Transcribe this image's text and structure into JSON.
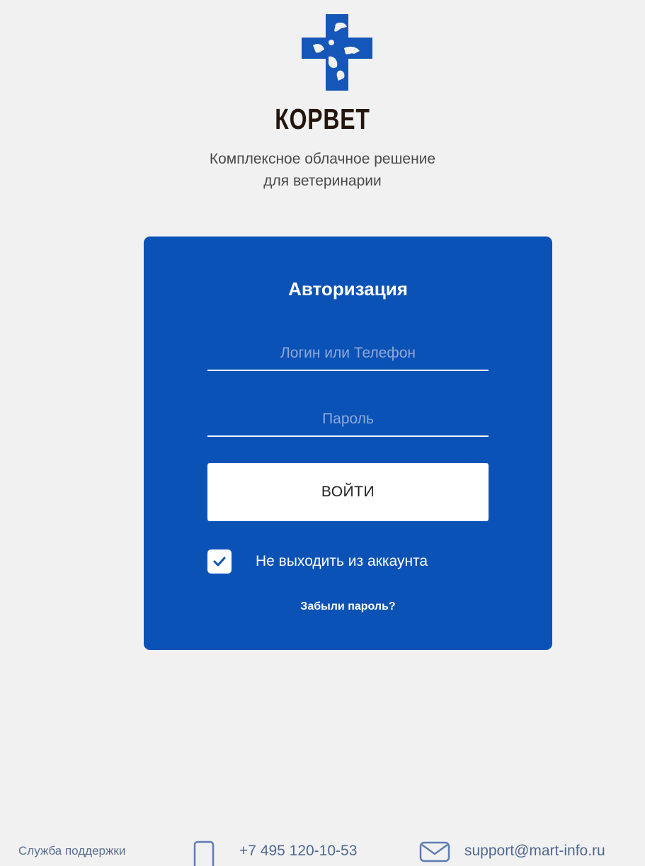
{
  "brand": {
    "name": "КОРВЕТ",
    "tagline_line1": "Комплексное облачное решение",
    "tagline_line2": "для ветеринарии",
    "logo_icon": "cross-with-animals-logo"
  },
  "login": {
    "title": "Авторизация",
    "login_field": {
      "placeholder": "Логин или Телефон",
      "value": ""
    },
    "password_field": {
      "placeholder": "Пароль",
      "value": ""
    },
    "submit_label": "ВОЙТИ",
    "remember": {
      "label": "Не выходить из аккаунта",
      "checked": true,
      "icon": "checkmark-icon"
    },
    "forgot_label": "Забыли пароль?"
  },
  "footer": {
    "support_label": "Служба поддержки",
    "phone": "+7 495 120-10-53",
    "phone_icon": "phone-icon",
    "email": "support@mart-info.ru",
    "email_icon": "envelope-icon"
  },
  "colors": {
    "background": "#f1f1f1",
    "card": "#0b52b6",
    "logo": "#1557b8",
    "brand_text": "#24160d",
    "footer_text": "#4f6892"
  }
}
